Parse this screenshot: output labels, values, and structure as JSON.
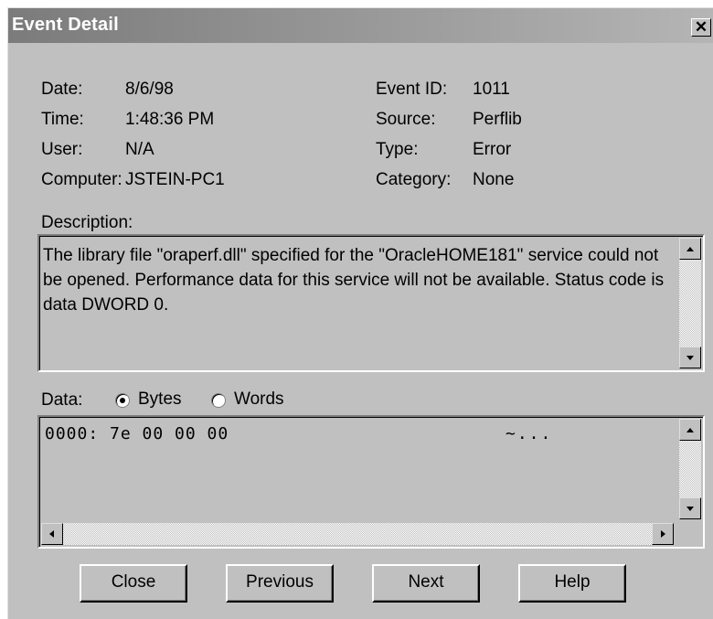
{
  "window": {
    "title": "Event Detail",
    "close_glyph": "✕"
  },
  "fields": {
    "date_label": "Date:",
    "date_value": "8/6/98",
    "time_label": "Time:",
    "time_value": "1:48:36 PM",
    "user_label": "User:",
    "user_value": "N/A",
    "computer_label": "Computer:",
    "computer_value": "JSTEIN-PC1",
    "eventid_label": "Event ID:",
    "eventid_value": "1011",
    "source_label": "Source:",
    "source_value": "Perflib",
    "type_label": "Type:",
    "type_value": "Error",
    "category_label": "Category:",
    "category_value": "None"
  },
  "description": {
    "label": "Description:",
    "text": "The library file \"oraperf.dll\" specified for the \"OracleHOME181\" service could not  be opened. Performance data for this service will not be available.  Status code is data DWORD 0."
  },
  "data": {
    "label": "Data:",
    "format_options": [
      {
        "label": "Bytes",
        "selected": true
      },
      {
        "label": "Words",
        "selected": false
      }
    ],
    "hex_line": "0000: 7e 00 00 00",
    "ascii_line": "~..."
  },
  "buttons": {
    "close": "Close",
    "previous": "Previous",
    "next": "Next",
    "help": "Help"
  },
  "colors": {
    "dialog_bg": "#c0c0c0",
    "titlebar_start": "#7b7b7b",
    "titlebar_end": "#b5b5b5"
  }
}
